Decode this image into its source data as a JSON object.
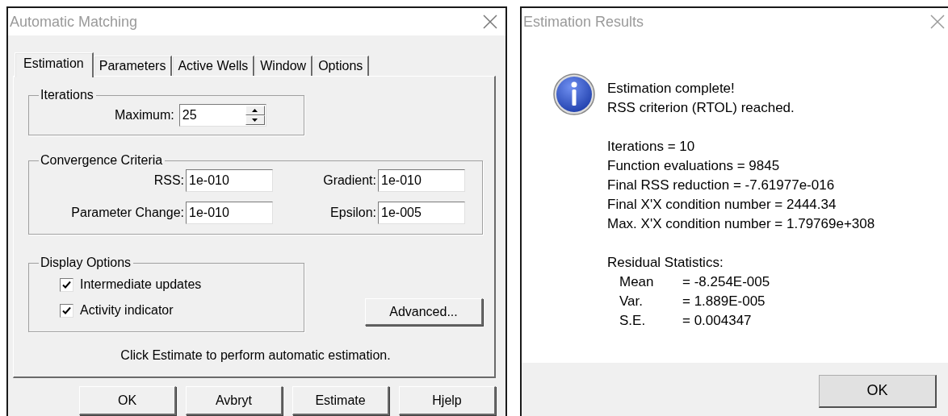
{
  "left_window": {
    "title": "Automatic Matching",
    "tabs": [
      {
        "label": "Estimation",
        "selected": true
      },
      {
        "label": "Parameters",
        "selected": false
      },
      {
        "label": "Active Wells",
        "selected": false
      },
      {
        "label": "Window",
        "selected": false
      },
      {
        "label": "Options",
        "selected": false
      }
    ],
    "iterations": {
      "legend": "Iterations",
      "label": "Maximum:",
      "value": "25"
    },
    "convergence": {
      "legend": "Convergence Criteria",
      "fields": [
        {
          "label": "RSS:",
          "value": "1e-010"
        },
        {
          "label": "Gradient:",
          "value": "1e-010"
        },
        {
          "label": "Parameter Change:",
          "value": "1e-010"
        },
        {
          "label": "Epsilon:",
          "value": "1e-005"
        }
      ]
    },
    "display_options": {
      "legend": "Display Options",
      "options": [
        {
          "label": "Intermediate updates",
          "checked": true
        },
        {
          "label": "Activity indicator",
          "checked": true
        }
      ]
    },
    "advanced_button": "Advanced...",
    "hint": "Click Estimate to perform automatic estimation.",
    "buttons": [
      "OK",
      "Avbryt",
      "Estimate",
      "Hjelp"
    ]
  },
  "right_window": {
    "title": "Estimation Results",
    "message": [
      "Estimation complete!",
      "RSS criterion (RTOL) reached."
    ],
    "stats": [
      "Iterations = 10",
      "Function evaluations = 9845",
      "Final RSS reduction = -7.61977e-016",
      "Final X'X condition number = 2444.34",
      "Max. X'X condition number = 1.79769e+308"
    ],
    "residual_heading": "Residual Statistics:",
    "residuals": [
      {
        "label": "Mean",
        "value": "= -8.254E-005"
      },
      {
        "label": "Var.",
        "value": "= 1.889E-005"
      },
      {
        "label": "S.E.",
        "value": "= 0.004347"
      }
    ],
    "buttons": [
      "OK"
    ]
  }
}
